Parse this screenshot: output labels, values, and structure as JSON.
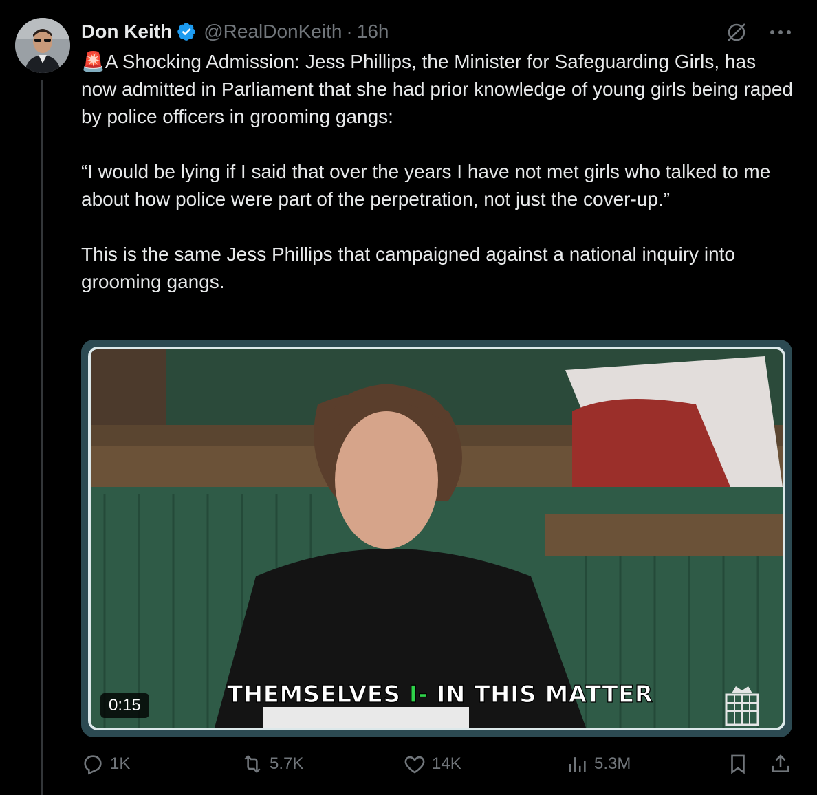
{
  "author": {
    "name": "Don Keith",
    "handle": "@RealDonKeith",
    "separator": "·",
    "time": "16h"
  },
  "tweet": {
    "paragraphs": [
      "🚨A Shocking Admission: Jess Phillips, the Minister for Safeguarding Girls, has now admitted in Parliament that she had prior knowledge of young girls being raped by police officers in grooming gangs:",
      "“I would be lying if I said that over the years I have not met girls who talked to me about how police were part of the perpetration, not just the cover-up.”",
      "This is the same Jess Phillips that campaigned against a national inquiry into grooming gangs."
    ]
  },
  "video": {
    "duration": "0:15",
    "caption_left": "THEMSELVES ",
    "caption_bar": "I-",
    "caption_right": " IN THIS MATTER"
  },
  "actions": {
    "replies": "1K",
    "reposts": "5.7K",
    "likes": "14K",
    "views": "5.3M"
  },
  "colors": {
    "accent": "#1d9bf0",
    "muted": "#71767b",
    "text": "#e7e9ea",
    "background": "#000000",
    "caption_highlight": "#2fd24a"
  }
}
